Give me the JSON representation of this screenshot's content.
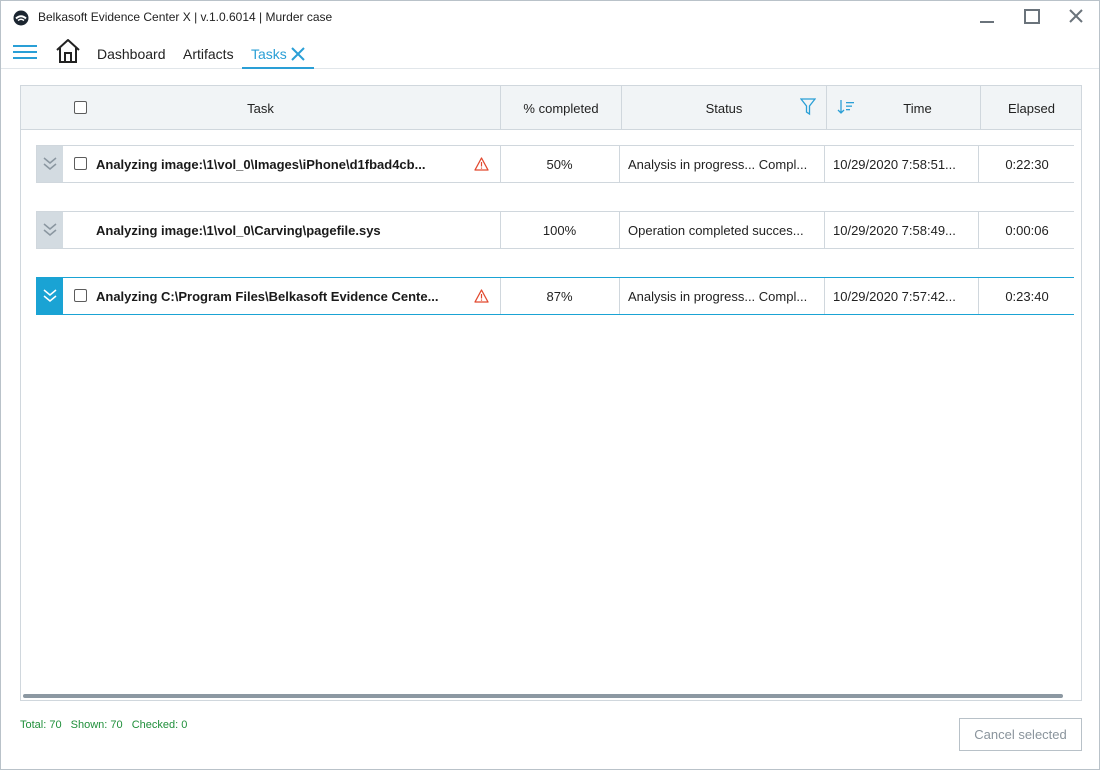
{
  "window": {
    "title": "Belkasoft Evidence Center X | v.1.0.6014 | Murder case"
  },
  "nav": {
    "tabs": [
      {
        "label": "Dashboard"
      },
      {
        "label": "Artifacts"
      },
      {
        "label": "Tasks",
        "active": true
      }
    ]
  },
  "grid": {
    "columns": {
      "task": "Task",
      "percent": "% completed",
      "status": "Status",
      "time": "Time",
      "elapsed": "Elapsed"
    },
    "rows": [
      {
        "task": "Analyzing image:\\1\\vol_0\\Images\\iPhone\\d1fbad4cb...",
        "percent": "50%",
        "status": "Analysis in progress... Compl...",
        "time": "10/29/2020 7:58:51...",
        "elapsed": "0:22:30",
        "warning": true,
        "checkbox": true
      },
      {
        "task": "Analyzing image:\\1\\vol_0\\Carving\\pagefile.sys",
        "percent": "100%",
        "status": "Operation completed succes...",
        "time": "10/29/2020 7:58:49...",
        "elapsed": "0:00:06",
        "warning": false,
        "checkbox": false
      },
      {
        "task": "Analyzing C:\\Program Files\\Belkasoft Evidence Cente...",
        "percent": "87%",
        "status": "Analysis in progress... Compl...",
        "time": "10/29/2020 7:57:42...",
        "elapsed": "0:23:40",
        "warning": true,
        "checkbox": true,
        "selected": true
      }
    ]
  },
  "footer": {
    "total": "Total: 70",
    "shown": "Shown: 70",
    "checked": "Checked: 0",
    "cancel_label": "Cancel selected"
  },
  "colors": {
    "accent": "#2a9fd6",
    "warning": "#e2492f",
    "stats_green": "#1f8f3a"
  }
}
